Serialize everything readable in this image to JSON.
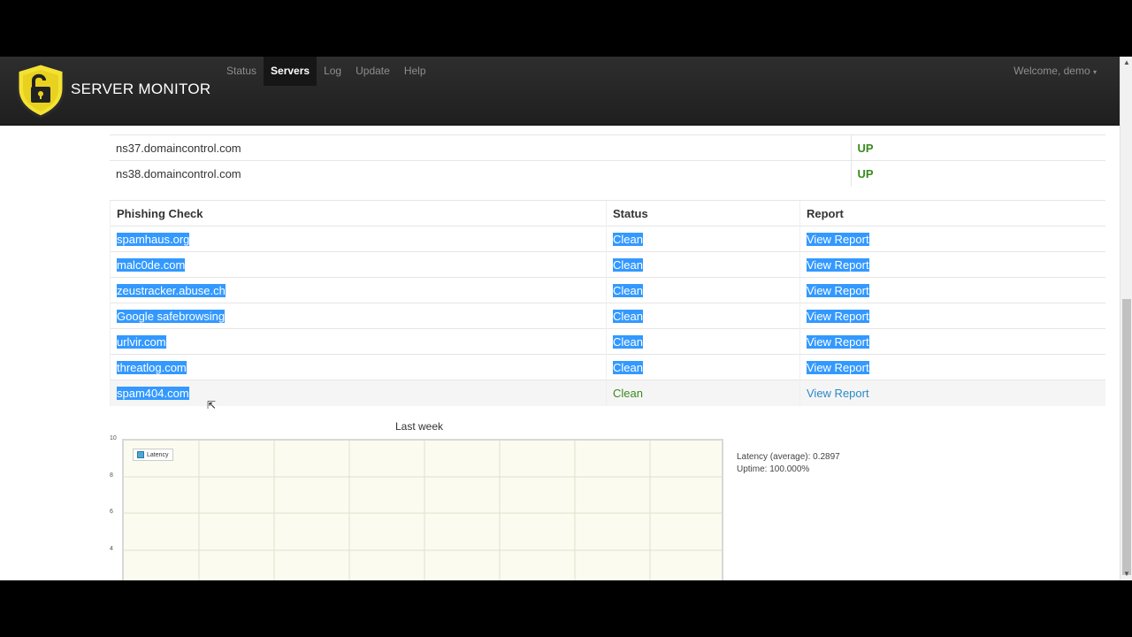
{
  "navbar": {
    "brand": "SERVER MONITOR",
    "links": [
      "Status",
      "Servers",
      "Log",
      "Update",
      "Help"
    ],
    "active": "Servers",
    "welcome": "Welcome, demo"
  },
  "nameservers": [
    {
      "host": "ns37.domaincontrol.com",
      "status": "UP"
    },
    {
      "host": "ns38.domaincontrol.com",
      "status": "UP"
    }
  ],
  "phishing": {
    "headers": {
      "check": "Phishing Check",
      "status": "Status",
      "report": "Report"
    },
    "rows": [
      {
        "check": "spamhaus.org",
        "status": "Clean",
        "report": "View Report"
      },
      {
        "check": "malc0de.com",
        "status": "Clean",
        "report": "View Report"
      },
      {
        "check": "zeustracker.abuse.ch",
        "status": "Clean",
        "report": "View Report"
      },
      {
        "check": "Google safebrowsing",
        "status": "Clean",
        "report": "View Report"
      },
      {
        "check": "urlvir.com",
        "status": "Clean",
        "report": "View Report"
      },
      {
        "check": "threatlog.com",
        "status": "Clean",
        "report": "View Report"
      },
      {
        "check": "spam404.com",
        "status": "Clean",
        "report": "View Report"
      }
    ]
  },
  "chart": {
    "title": "Last week",
    "legend": "Latency",
    "y_ticks": [
      "10",
      "8",
      "6",
      "4"
    ]
  },
  "stats": {
    "latency": "Latency (average): 0.2897",
    "uptime": "Uptime: 100.000%"
  },
  "colors": {
    "up": "#3a8a1f",
    "link": "#2a8ac6",
    "selection": "#3399ff"
  }
}
